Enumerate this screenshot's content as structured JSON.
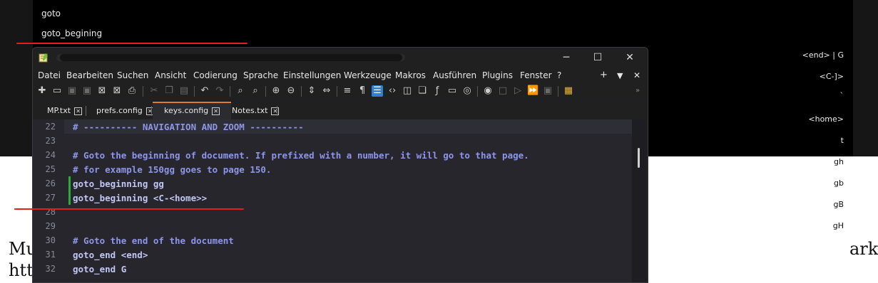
{
  "background_panel": {
    "commands": [
      "goto",
      "goto_begining"
    ],
    "keys": [
      "<end> | G",
      "<C-]>",
      "`",
      "<home>",
      "t",
      "gh",
      "gb",
      "gB",
      "gH"
    ],
    "doc_text_left": [
      "Mu",
      "htt"
    ],
    "doc_text_right": "ark"
  },
  "window": {
    "title": "",
    "buttons": {
      "minimize": "─",
      "maximize": "☐",
      "close": "✕"
    }
  },
  "menu": {
    "items": [
      "Datei",
      "Bearbeiten",
      "Suchen",
      "Ansicht",
      "Codierung",
      "Sprache",
      "Einstellungen",
      "Werkzeuge",
      "Makros",
      "Ausführen",
      "Plugins",
      "Fenster",
      "?"
    ],
    "right": {
      "plus": "+",
      "dropdown": "▼",
      "close": "✕"
    }
  },
  "tabs": [
    {
      "label": "MP.txt",
      "close": "✕"
    },
    {
      "label": "prefs.config",
      "close": "✕"
    },
    {
      "label": "keys.config",
      "close": "✕"
    },
    {
      "label": "Notes.txt",
      "close": "✕"
    }
  ],
  "active_tab": "keys.config",
  "editor": {
    "lines": [
      {
        "n": "22",
        "text": "# ---------- NAVIGATION AND ZOOM ----------",
        "kind": "comment"
      },
      {
        "n": "23",
        "text": "",
        "kind": "plain"
      },
      {
        "n": "24",
        "text": "# Goto the beginning of document. If prefixed with a number, it will go to that page.",
        "kind": "comment"
      },
      {
        "n": "25",
        "text": "# for example 150gg goes to page 150.",
        "kind": "comment"
      },
      {
        "n": "26",
        "text": "goto_beginning gg",
        "kind": "plain"
      },
      {
        "n": "27",
        "text": "goto_beginning <C-<home>>",
        "kind": "plain"
      },
      {
        "n": "28",
        "text": "",
        "kind": "plain"
      },
      {
        "n": "29",
        "text": "",
        "kind": "plain"
      },
      {
        "n": "30",
        "text": "# Goto the end of the document",
        "kind": "comment"
      },
      {
        "n": "31",
        "text": "goto_end <end>",
        "kind": "plain"
      },
      {
        "n": "32",
        "text": "goto_end G",
        "kind": "plain"
      }
    ]
  },
  "colors": {
    "annotation_red": "#e02020",
    "change_marker_green": "#2eaa3a",
    "active_tab_accent": "#e07a2c",
    "comment": "#8f95e8",
    "code": "#c2c6f2"
  }
}
